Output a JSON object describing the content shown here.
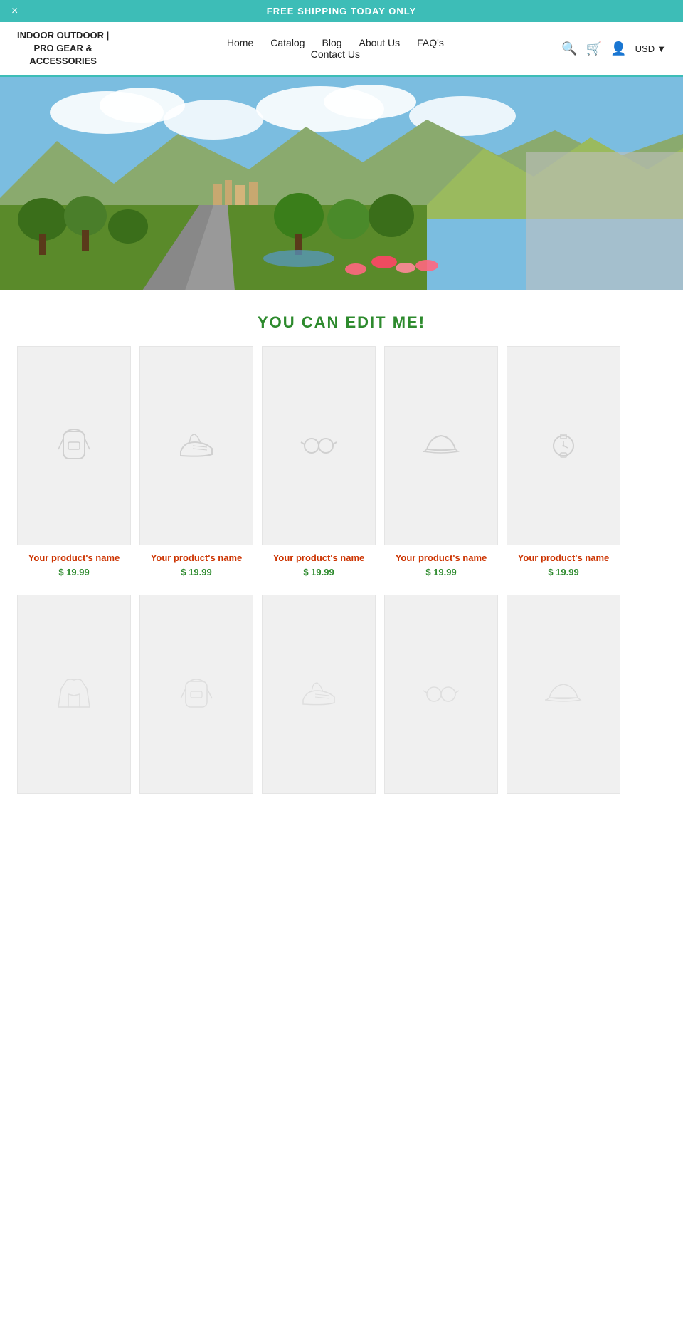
{
  "announcement": {
    "text": "FREE SHIPPING TODAY ONLY",
    "close_label": "×"
  },
  "header": {
    "logo_line1": "INDOOR OUTDOOR |",
    "logo_line2": "PRO GEAR &",
    "logo_line3": "ACCESSORIES",
    "nav": {
      "items": [
        {
          "label": "Home",
          "href": "#"
        },
        {
          "label": "Catalog",
          "href": "#"
        },
        {
          "label": "Blog",
          "href": "#"
        },
        {
          "label": "About Us",
          "href": "#"
        },
        {
          "label": "FAQ's",
          "href": "#"
        }
      ],
      "items_row2": [
        {
          "label": "Contact Us",
          "href": "#"
        }
      ]
    },
    "currency": "USD"
  },
  "main": {
    "section_heading": "YOU CAN EDIT ME!",
    "products_row1": [
      {
        "name": "Your product's name",
        "price": "$ 19.99",
        "icon": "backpack"
      },
      {
        "name": "Your product's name",
        "price": "$ 19.99",
        "icon": "shoe"
      },
      {
        "name": "Your product's name",
        "price": "$ 19.99",
        "icon": "glasses"
      },
      {
        "name": "Your product's name",
        "price": "$ 19.99",
        "icon": "cap"
      },
      {
        "name": "Your product's name",
        "price": "$ 19.99",
        "icon": "watch"
      }
    ],
    "products_row2": [
      {
        "name": "",
        "price": "",
        "icon": "jacket"
      },
      {
        "name": "",
        "price": "",
        "icon": "backpack2"
      },
      {
        "name": "",
        "price": "",
        "icon": "shoe2"
      },
      {
        "name": "",
        "price": "",
        "icon": "glasses2"
      },
      {
        "name": "",
        "price": "",
        "icon": "cap2"
      }
    ]
  }
}
